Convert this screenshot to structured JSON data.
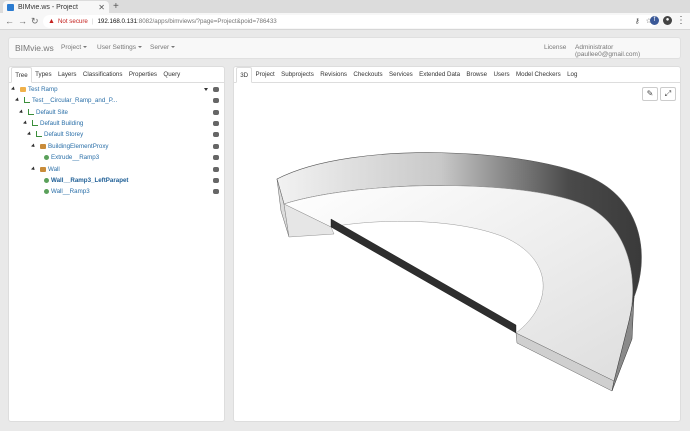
{
  "browser": {
    "tab_title": "BIMvie.ws - Project",
    "not_secure": "Not secure",
    "url_host": "192.168.0.131",
    "url_path": ":8082/apps/bimviews/?page=Project&poid=786433"
  },
  "navbar": {
    "brand": "BIMvie.ws",
    "project": "Project",
    "user_settings": "User Settings",
    "server": "Server",
    "license": "License",
    "user": "Administrator (paullee0@gmail.com)"
  },
  "left_tabs": [
    "Tree",
    "Types",
    "Layers",
    "Classifications",
    "Properties",
    "Query"
  ],
  "right_tabs": [
    "3D",
    "Project",
    "Subprojects",
    "Revisions",
    "Checkouts",
    "Services",
    "Extended Data",
    "Browse",
    "Users",
    "Model Checkers",
    "Log"
  ],
  "tree": [
    {
      "label": "Test Ramp",
      "icon": "folder-icon"
    },
    {
      "label": "Test__Circular_Ramp_and_P...",
      "icon": "structure-icon"
    },
    {
      "label": "Default Site",
      "icon": "structure-icon"
    },
    {
      "label": "Default Building",
      "icon": "structure-icon"
    },
    {
      "label": "Default Storey",
      "icon": "structure-icon"
    },
    {
      "label": "BuildingElementProxy",
      "icon": "box-icon"
    },
    {
      "label": "Extrude__Ramp3",
      "icon": "object-icon"
    },
    {
      "label": "Wall",
      "icon": "box-icon"
    },
    {
      "label": "Wall__Ramp3_LeftParapet",
      "icon": "object-icon"
    },
    {
      "label": "Wall__Ramp3",
      "icon": "object-icon"
    }
  ],
  "viewer_tools": [
    "wrench-icon",
    "expand-icon"
  ]
}
